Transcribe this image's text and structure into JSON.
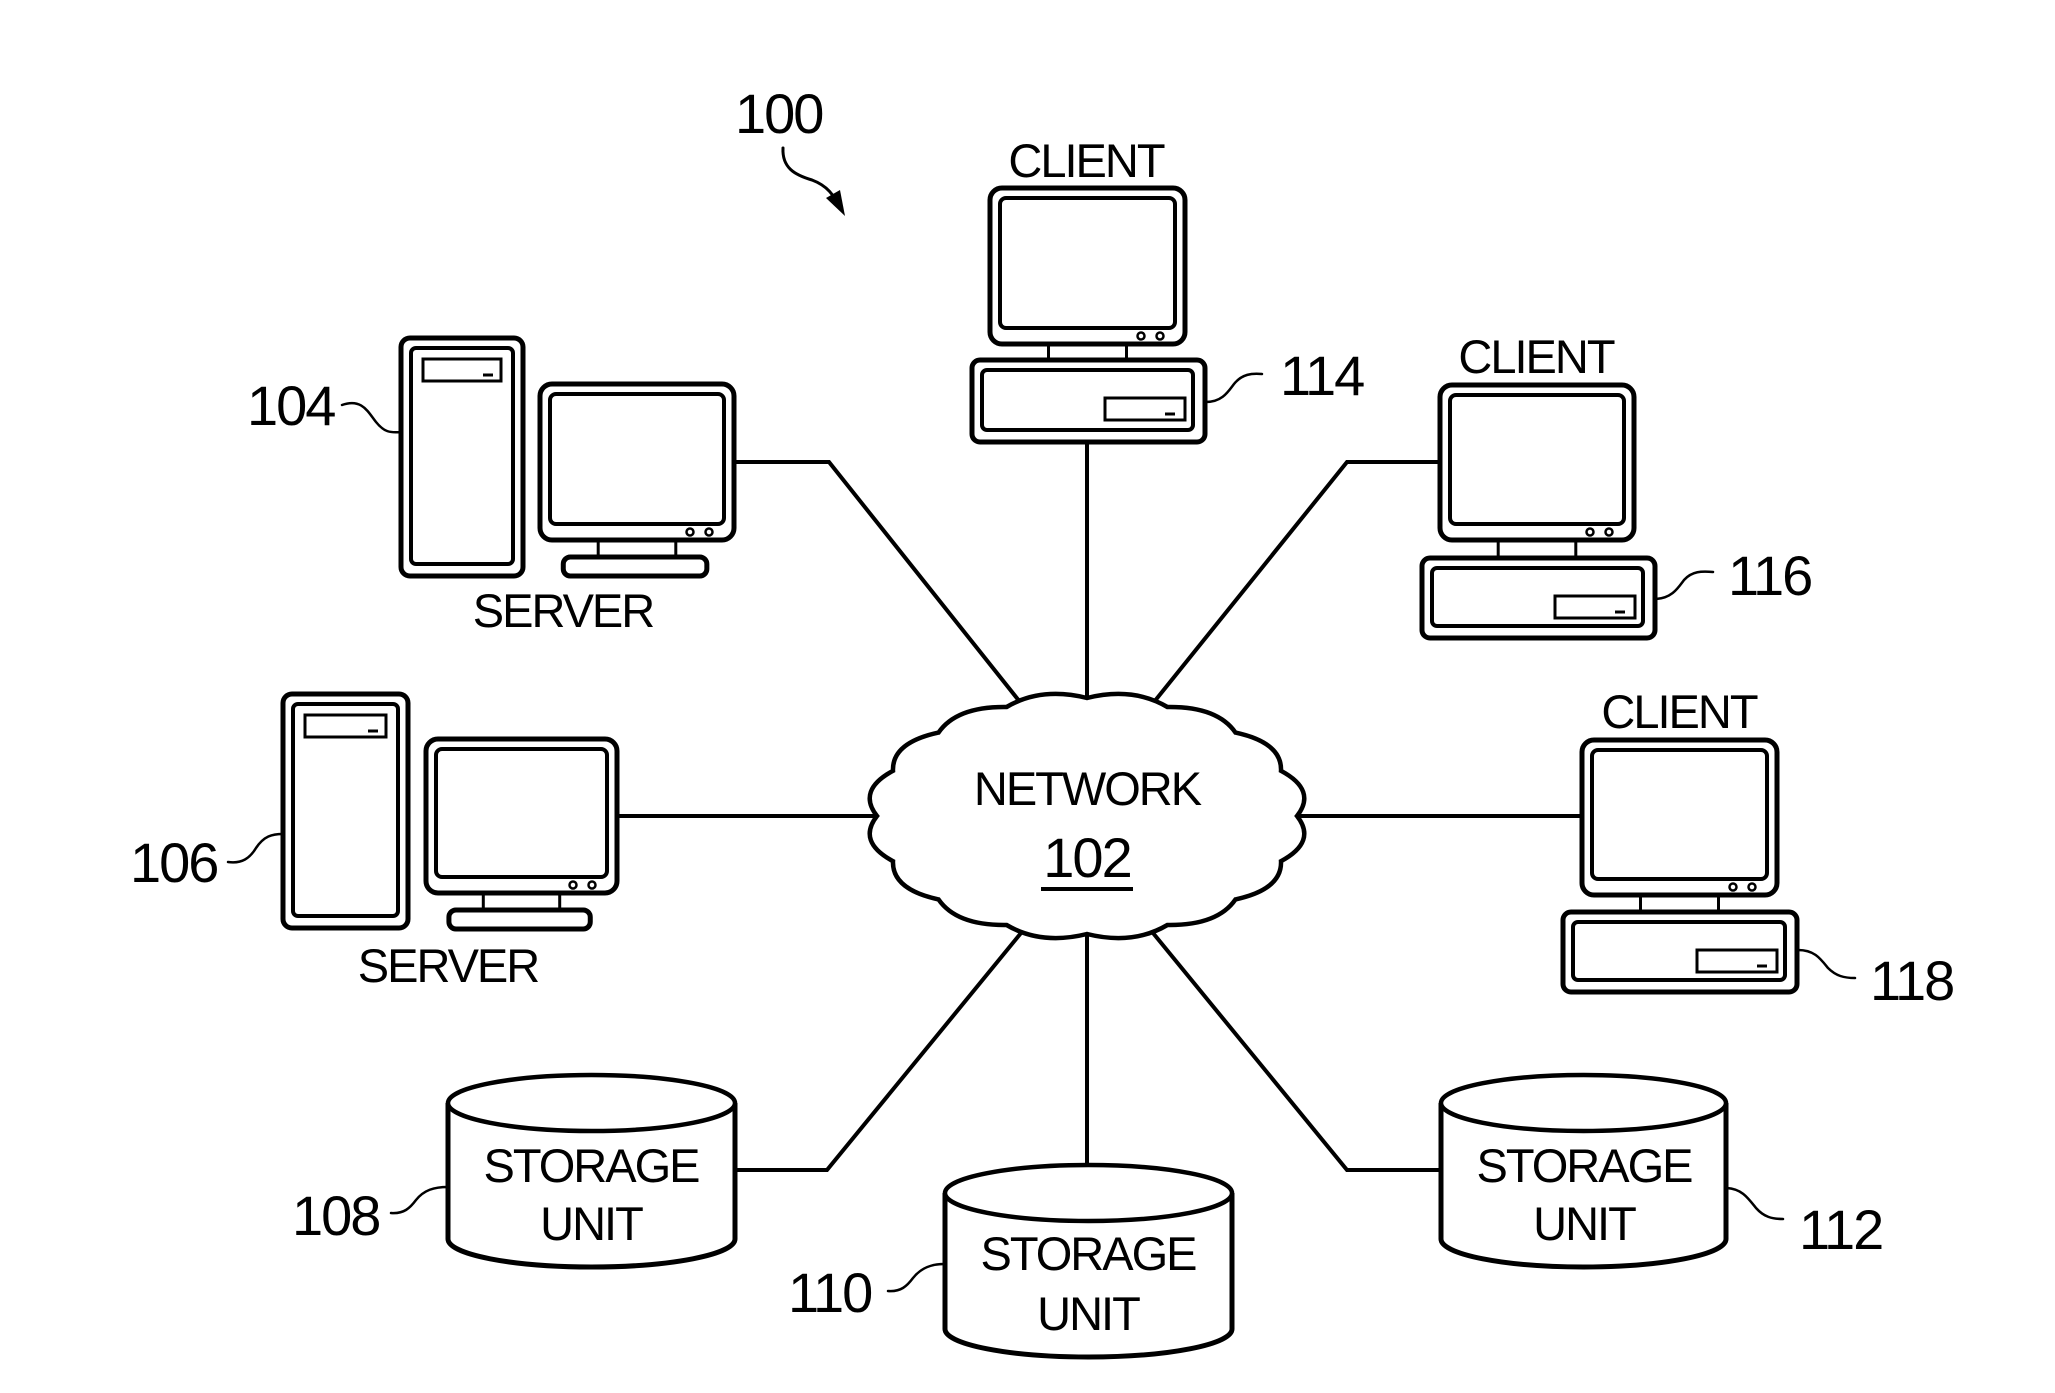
{
  "figure": {
    "reference": "100",
    "colors": {
      "ink": "#000000",
      "background": "#ffffff"
    }
  },
  "network": {
    "label": "NETWORK",
    "reference": "102"
  },
  "servers": [
    {
      "id": "server-104",
      "label": "SERVER",
      "reference": "104"
    },
    {
      "id": "server-106",
      "label": "SERVER",
      "reference": "106"
    }
  ],
  "storage_units": [
    {
      "id": "storage-108",
      "label_line1": "STORAGE",
      "label_line2": "UNIT",
      "reference": "108"
    },
    {
      "id": "storage-110",
      "label_line1": "STORAGE",
      "label_line2": "UNIT",
      "reference": "110"
    },
    {
      "id": "storage-112",
      "label_line1": "STORAGE",
      "label_line2": "UNIT",
      "reference": "112"
    }
  ],
  "clients": [
    {
      "id": "client-114",
      "label": "CLIENT",
      "reference": "114"
    },
    {
      "id": "client-116",
      "label": "CLIENT",
      "reference": "116"
    },
    {
      "id": "client-118",
      "label": "CLIENT",
      "reference": "118"
    }
  ]
}
